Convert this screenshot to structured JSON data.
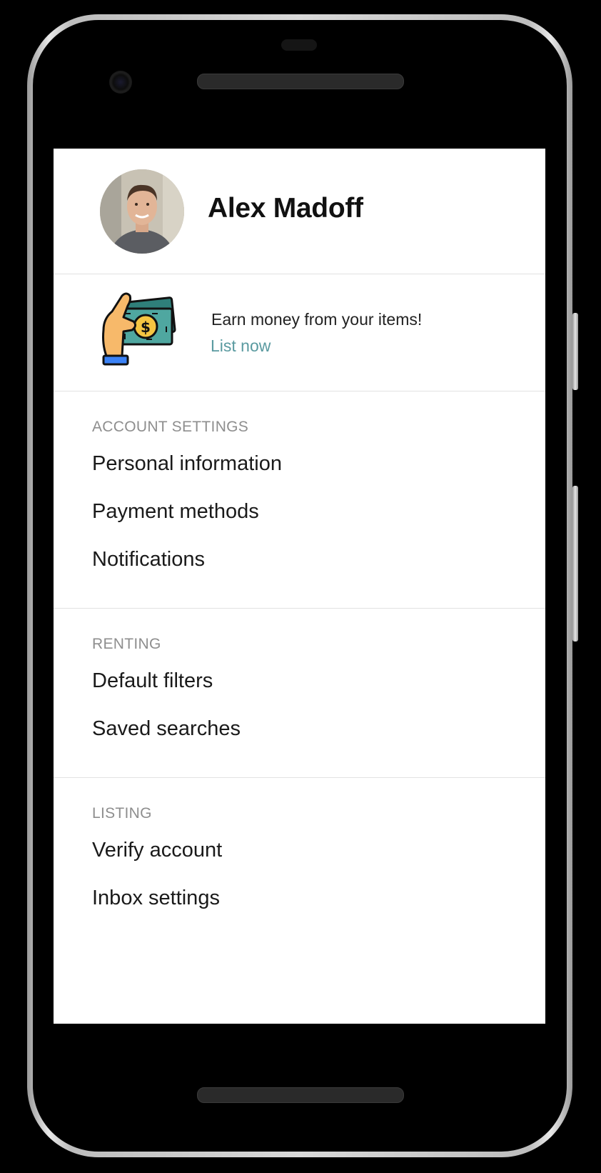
{
  "profile": {
    "name": "Alex Madoff"
  },
  "promo": {
    "text": "Earn money from your items!",
    "link_label": "List now"
  },
  "sections": [
    {
      "title": "ACCOUNT SETTINGS",
      "items": [
        "Personal information",
        "Payment methods",
        "Notifications"
      ]
    },
    {
      "title": "RENTING",
      "items": [
        "Default filters",
        "Saved searches"
      ]
    },
    {
      "title": "LISTING",
      "items": [
        "Verify account",
        "Inbox settings"
      ]
    }
  ],
  "colors": {
    "link": "#5a9aa0",
    "section_title": "#8e8e8e",
    "icon_cash": "#3f8f8a",
    "icon_coin": "#f5c542",
    "icon_hand": "#f7b96a",
    "icon_cuff": "#3b82f6"
  },
  "icons": {
    "promo": "hand-holding-cash-icon"
  }
}
